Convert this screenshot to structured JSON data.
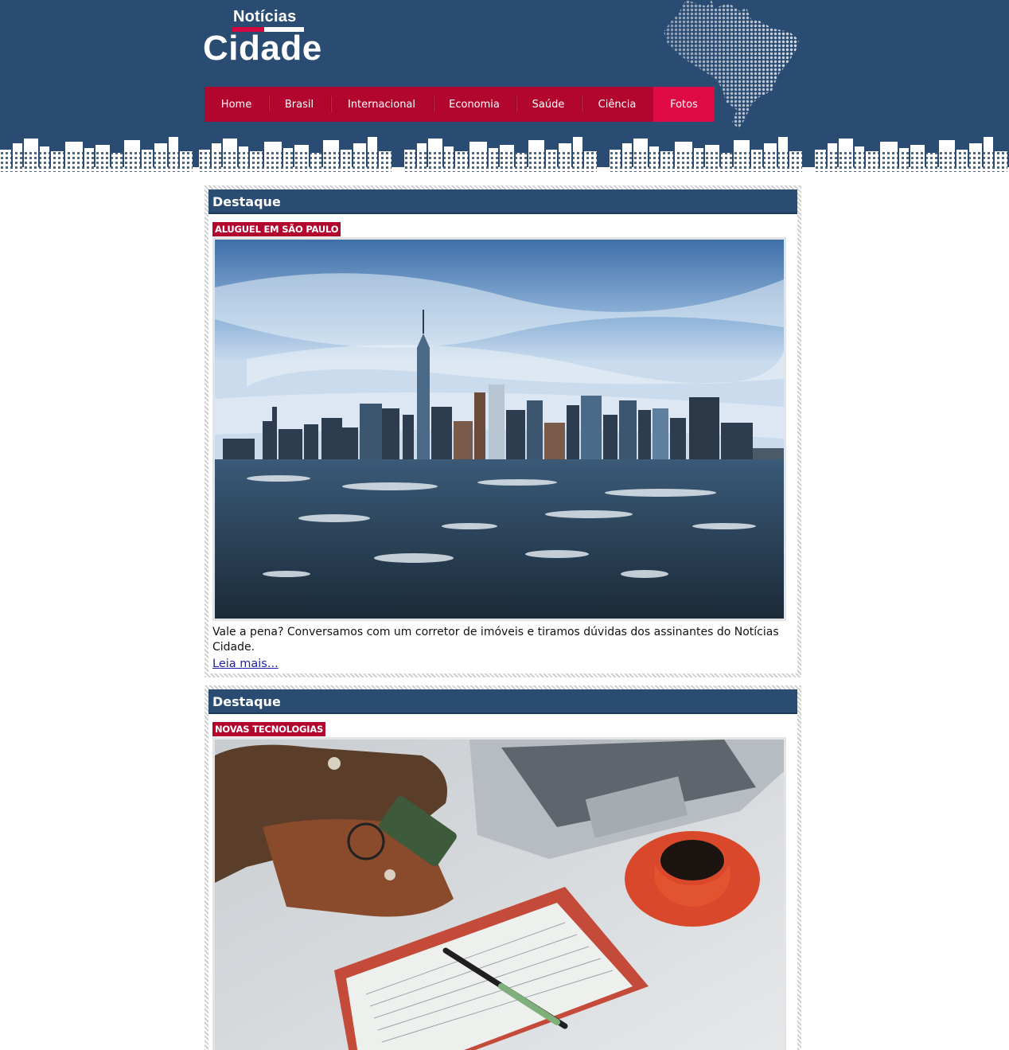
{
  "site": {
    "logo_small": "Notícias",
    "logo_big": "Cidade"
  },
  "nav": {
    "items": [
      {
        "label": "Home"
      },
      {
        "label": "Brasil"
      },
      {
        "label": "Internacional"
      },
      {
        "label": "Economia"
      },
      {
        "label": "Saúde"
      },
      {
        "label": "Ciência"
      },
      {
        "label": "Fotos",
        "active": true
      }
    ]
  },
  "articles": [
    {
      "section": "Destaque",
      "tag": "ALUGUEL EM SÃO PAULO",
      "summary": "Vale a pena? Conversamos com um corretor de imóveis e tiramos dúvidas dos assinantes do Notícias Cidade.",
      "link": "Leia mais..."
    },
    {
      "section": "Destaque",
      "tag": "NOVAS TECNOLOGIAS"
    }
  ],
  "colors": {
    "header_bg": "#2b4c72",
    "nav_bg": "#b3062f",
    "nav_active": "#e00a44",
    "tag_bg": "#b3062f",
    "link": "#1f1fa8"
  }
}
